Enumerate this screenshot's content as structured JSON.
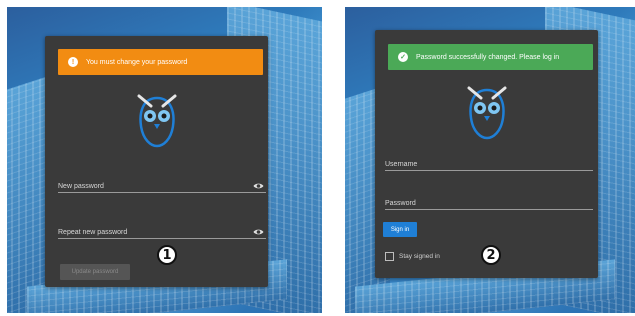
{
  "panels": [
    {
      "banner": {
        "text": "You must change your password",
        "icon": "info-icon",
        "color": "#f28c12"
      },
      "fields": [
        {
          "label": "New password",
          "icon": "eye-icon"
        },
        {
          "label": "Repeat new password",
          "icon": "eye-icon"
        }
      ],
      "button": {
        "label": "Update password"
      },
      "step": "1"
    },
    {
      "banner": {
        "text": "Password successfully changed. Please log in",
        "icon": "check-icon",
        "color": "#4ba957"
      },
      "fields": [
        {
          "label": "Username"
        },
        {
          "label": "Password"
        }
      ],
      "button": {
        "label": "Sign in",
        "color": "#1f7fd6"
      },
      "checkbox": {
        "label": "Stay signed in",
        "checked": false
      },
      "step": "2"
    }
  ]
}
